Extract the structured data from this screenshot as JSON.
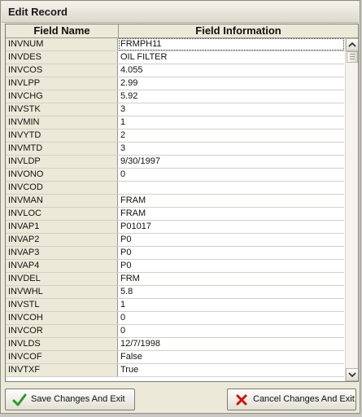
{
  "window": {
    "title": "Edit Record"
  },
  "grid": {
    "headers": {
      "field_name": "Field Name",
      "field_info": "Field Information"
    },
    "rows": [
      {
        "name": "INVNUM",
        "value": "FRMPH11"
      },
      {
        "name": "INVDES",
        "value": "OIL FILTER"
      },
      {
        "name": "INVCOS",
        "value": "4.055"
      },
      {
        "name": "INVLPP",
        "value": "2.99"
      },
      {
        "name": "INVCHG",
        "value": "5.92"
      },
      {
        "name": "INVSTK",
        "value": "3"
      },
      {
        "name": "INVMIN",
        "value": "1"
      },
      {
        "name": "INVYTD",
        "value": "2"
      },
      {
        "name": "INVMTD",
        "value": "3"
      },
      {
        "name": "INVLDP",
        "value": "9/30/1997"
      },
      {
        "name": "INVONO",
        "value": "0"
      },
      {
        "name": "INVCOD",
        "value": ""
      },
      {
        "name": "INVMAN",
        "value": "FRAM"
      },
      {
        "name": "INVLOC",
        "value": "FRAM"
      },
      {
        "name": "INVAP1",
        "value": "P01017"
      },
      {
        "name": "INVAP2",
        "value": "P0"
      },
      {
        "name": "INVAP3",
        "value": "P0"
      },
      {
        "name": "INVAP4",
        "value": "P0"
      },
      {
        "name": "INVDEL",
        "value": "FRM"
      },
      {
        "name": "INVWHL",
        "value": "5.8"
      },
      {
        "name": "INVSTL",
        "value": "1"
      },
      {
        "name": "INVCOH",
        "value": "0"
      },
      {
        "name": "INVCOR",
        "value": "0"
      },
      {
        "name": "INVLDS",
        "value": "12/7/1998"
      },
      {
        "name": "INVCOF",
        "value": "False"
      },
      {
        "name": "INVTXF",
        "value": "True"
      }
    ],
    "scroll_fraction": 0
  },
  "buttons": {
    "save": {
      "label": "Save Changes And Exit",
      "icon": "green-checkmark-icon"
    },
    "cancel": {
      "label": "Cancel Changes And Exit",
      "icon": "red-x-icon"
    }
  },
  "colors": {
    "check_green": "#2e9a2a",
    "cancel_red": "#d01010"
  }
}
